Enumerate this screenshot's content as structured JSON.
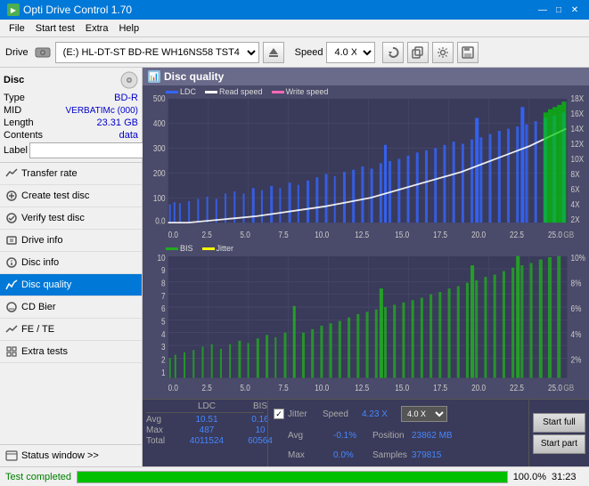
{
  "app": {
    "title": "Opti Drive Control 1.70",
    "icon": "ODC"
  },
  "titlebar": {
    "minimize": "—",
    "maximize": "□",
    "close": "✕"
  },
  "menubar": {
    "items": [
      "File",
      "Start test",
      "Extra",
      "Help"
    ]
  },
  "toolbar": {
    "drive_label": "Drive",
    "drive_value": "(E:) HL-DT-ST BD-RE  WH16NS58 TST4",
    "speed_label": "Speed",
    "speed_value": "4.0 X"
  },
  "disc_panel": {
    "title": "Disc",
    "type_label": "Type",
    "type_value": "BD-R",
    "mid_label": "MID",
    "mid_value": "VERBATIMc (000)",
    "length_label": "Length",
    "length_value": "23.31 GB",
    "contents_label": "Contents",
    "contents_value": "data",
    "label_label": "Label",
    "label_placeholder": ""
  },
  "nav": {
    "items": [
      {
        "id": "transfer-rate",
        "label": "Transfer rate",
        "active": false
      },
      {
        "id": "create-test-disc",
        "label": "Create test disc",
        "active": false
      },
      {
        "id": "verify-test-disc",
        "label": "Verify test disc",
        "active": false
      },
      {
        "id": "drive-info",
        "label": "Drive info",
        "active": false
      },
      {
        "id": "disc-info",
        "label": "Disc info",
        "active": false
      },
      {
        "id": "disc-quality",
        "label": "Disc quality",
        "active": true
      },
      {
        "id": "cd-bier",
        "label": "CD Bier",
        "active": false
      },
      {
        "id": "fe-te",
        "label": "FE / TE",
        "active": false
      },
      {
        "id": "extra-tests",
        "label": "Extra tests",
        "active": false
      }
    ],
    "status_window": "Status window >>"
  },
  "disc_quality": {
    "title": "Disc quality",
    "legend": {
      "ldc_label": "LDC",
      "read_speed_label": "Read speed",
      "write_speed_label": "Write speed"
    },
    "legend2": {
      "bis_label": "BIS",
      "jitter_label": "Jitter"
    },
    "chart1": {
      "y_left": [
        "500",
        "400",
        "300",
        "200",
        "100",
        "0.0"
      ],
      "y_right": [
        "18X",
        "16X",
        "14X",
        "12X",
        "10X",
        "8X",
        "6X",
        "4X",
        "2X"
      ],
      "x_labels": [
        "0.0",
        "2.5",
        "5.0",
        "7.5",
        "10.0",
        "12.5",
        "15.0",
        "17.5",
        "20.0",
        "22.5",
        "25.0"
      ],
      "x_unit": "GB"
    },
    "chart2": {
      "y_left": [
        "10",
        "9",
        "8",
        "7",
        "6",
        "5",
        "4",
        "3",
        "2",
        "1"
      ],
      "y_right": [
        "10%",
        "8%",
        "6%",
        "4%",
        "2%"
      ],
      "x_labels": [
        "0.0",
        "2.5",
        "5.0",
        "7.5",
        "10.0",
        "12.5",
        "15.0",
        "17.5",
        "20.0",
        "22.5",
        "25.0"
      ],
      "x_unit": "GB"
    }
  },
  "stats": {
    "columns": [
      "LDC",
      "BIS"
    ],
    "jitter_col": "Jitter",
    "rows": [
      {
        "label": "Avg",
        "ldc": "10.51",
        "bis": "0.16",
        "jitter": "-0.1%"
      },
      {
        "label": "Max",
        "ldc": "487",
        "bis": "10",
        "jitter": "0.0%"
      },
      {
        "label": "Total",
        "ldc": "4011524",
        "bis": "60564",
        "jitter": ""
      }
    ],
    "speed_label": "Speed",
    "speed_value": "4.23 X",
    "speed_select": "4.0 X",
    "position_label": "Position",
    "position_value": "23862 MB",
    "samples_label": "Samples",
    "samples_value": "379815",
    "start_full": "Start full",
    "start_part": "Start part",
    "jitter_checked": true
  },
  "progress": {
    "label": "Test completed",
    "percent": "100.0%",
    "time": "31:23",
    "fill_width": "100%"
  },
  "colors": {
    "accent_blue": "#0078d7",
    "ldc_color": "#3366ff",
    "read_speed_color": "#ffffff",
    "write_speed_color": "#ff69b4",
    "bis_color": "#22aa22",
    "jitter_color": "#ffff00",
    "chart_bg": "#3a3a5a",
    "bar_green": "#00cc00",
    "active_nav": "#0078d7"
  }
}
